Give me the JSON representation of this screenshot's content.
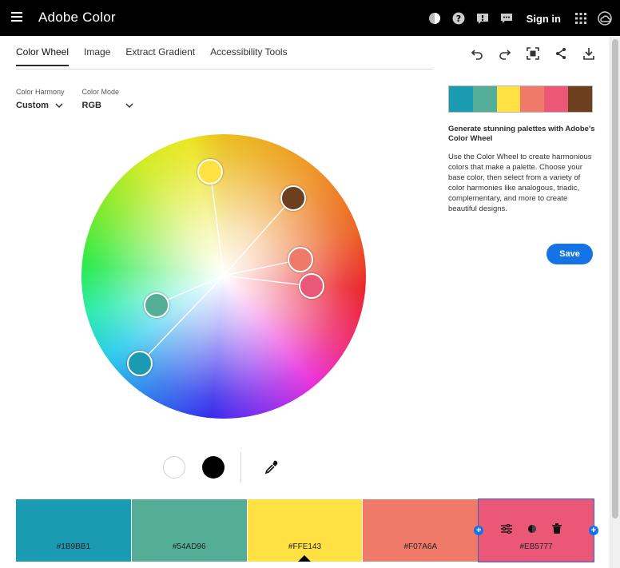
{
  "app": {
    "title": "Adobe Color",
    "sign_in": "Sign in"
  },
  "topbar_icons": [
    "theme-icon",
    "help-icon",
    "feedback-icon",
    "chat-icon",
    "apps-grid-icon",
    "creative-cloud-icon"
  ],
  "tabs": [
    {
      "label": "Color Wheel",
      "active": true
    },
    {
      "label": "Image",
      "active": false
    },
    {
      "label": "Extract Gradient",
      "active": false
    },
    {
      "label": "Accessibility Tools",
      "active": false
    }
  ],
  "toolbar": [
    "undo-icon",
    "redo-icon",
    "fullscreen-icon",
    "share-icon",
    "download-icon"
  ],
  "color_harmony": {
    "label": "Color Harmony",
    "value": "Custom"
  },
  "color_mode": {
    "label": "Color Mode",
    "value": "RGB"
  },
  "palette": [
    {
      "hex": "#1B9BB1",
      "color": "#1B9BB1"
    },
    {
      "hex": "#54AD96",
      "color": "#54AD96"
    },
    {
      "hex": "#FFE143",
      "color": "#FFE143"
    },
    {
      "hex": "#F07A6A",
      "color": "#F07A6A"
    },
    {
      "hex": "#EB5777",
      "color": "#EB5777"
    }
  ],
  "mini_palette_colors": [
    "#1B9BB1",
    "#54AD96",
    "#FFE143",
    "#F07A6A",
    "#EB5777",
    "#6E3F1F"
  ],
  "wheel_handles": [
    {
      "color": "#FFE143",
      "name": "handle-yellow"
    },
    {
      "color": "#6E3F1F",
      "name": "handle-brown"
    },
    {
      "color": "#F07A6A",
      "name": "handle-salmon"
    },
    {
      "color": "#EB5777",
      "name": "handle-pink"
    },
    {
      "color": "#54AD96",
      "name": "handle-green"
    },
    {
      "color": "#1B9BB1",
      "name": "handle-teal"
    }
  ],
  "info": {
    "title": "Generate stunning palettes with Adobe's Color Wheel",
    "body": "Use the Color Wheel to create harmonious colors that make a palette. Choose your base color, then select from a variety of color harmonies like analogous, triadic, complementary, and more to create beautiful designs."
  },
  "save_label": "Save",
  "accent": "#1473E6"
}
